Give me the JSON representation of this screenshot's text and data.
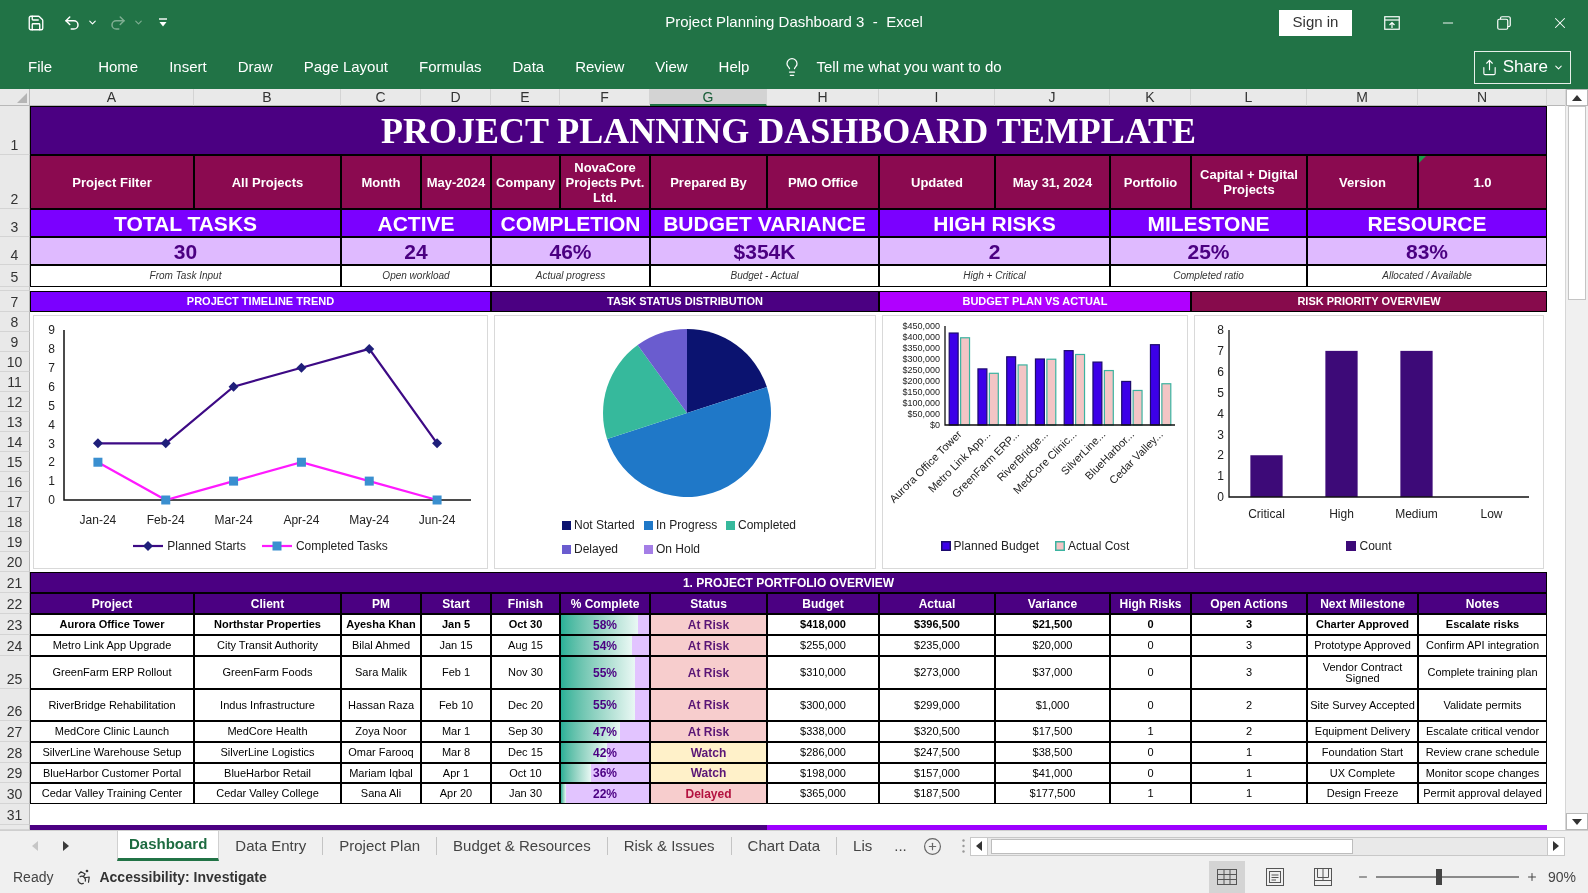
{
  "title_bar": {
    "title": "Project Planning Dashboard 3  -  Excel",
    "sign_in": "Sign in"
  },
  "ribbon": {
    "tabs": [
      "File",
      "Home",
      "Insert",
      "Draw",
      "Page Layout",
      "Formulas",
      "Data",
      "Review",
      "View",
      "Help"
    ],
    "tell_me": "Tell me what you want to do",
    "share": "Share"
  },
  "sheet": {
    "columns": [
      {
        "label": "A",
        "selected": false
      },
      {
        "label": "B",
        "selected": false
      },
      {
        "label": "C",
        "selected": false
      },
      {
        "label": "D",
        "selected": false
      },
      {
        "label": "E",
        "selected": false
      },
      {
        "label": "F",
        "selected": false
      },
      {
        "label": "G",
        "selected": true
      },
      {
        "label": "H",
        "selected": false
      },
      {
        "label": "I",
        "selected": false
      },
      {
        "label": "J",
        "selected": false
      },
      {
        "label": "K",
        "selected": false
      },
      {
        "label": "L",
        "selected": false
      },
      {
        "label": "M",
        "selected": false
      },
      {
        "label": "N",
        "selected": false
      }
    ],
    "row_numbers": [
      "1",
      "2",
      "3",
      "4",
      "5",
      "7",
      "8",
      "9",
      "10",
      "11",
      "12",
      "13",
      "14",
      "15",
      "16",
      "17",
      "18",
      "19",
      "20",
      "21",
      "22",
      "23",
      "24",
      "25",
      "26",
      "27",
      "28",
      "29",
      "30",
      "31"
    ],
    "title": "PROJECT PLANNING DASHBOARD TEMPLATE",
    "info": [
      {
        "label": "Project Filter",
        "value": "All Projects",
        "flagged": false
      },
      {
        "label": "Month",
        "value": "May-2024",
        "flagged": false
      },
      {
        "label": "Company",
        "value": "NovaCore Projects Pvt. Ltd.",
        "flagged": false
      },
      {
        "label": "Prepared By",
        "value": "PMO Office",
        "flagged": false
      },
      {
        "label": "Updated",
        "value": "May 31, 2024",
        "flagged": false
      },
      {
        "label": "Portfolio",
        "value": "Capital + Digital Projects",
        "flagged": false
      },
      {
        "label": "Version",
        "value": "1.0",
        "flagged": true
      }
    ],
    "kpis": [
      {
        "title": "TOTAL TASKS",
        "value": "30",
        "note": "From Task Input"
      },
      {
        "title": "ACTIVE",
        "value": "24",
        "note": "Open workload"
      },
      {
        "title": "COMPLETION",
        "value": "46%",
        "note": "Actual progress"
      },
      {
        "title": "BUDGET VARIANCE",
        "value": "$354K",
        "note": "Budget - Actual"
      },
      {
        "title": "HIGH RISKS",
        "value": "2",
        "note": "High + Critical"
      },
      {
        "title": "MILESTONE",
        "value": "25%",
        "note": "Completed ratio"
      },
      {
        "title": "RESOURCE",
        "value": "83%",
        "note": "Allocated / Available"
      }
    ],
    "charts": [
      {
        "title": "PROJECT TIMELINE TREND",
        "color": "#7b00ff",
        "chart_data": {
          "type": "line",
          "categories": [
            "Jan-24",
            "Feb-24",
            "Mar-24",
            "Apr-24",
            "May-24",
            "Jun-24"
          ],
          "series": [
            {
              "name": "Planned Starts",
              "color": "#3d0a85",
              "marker": "diamond",
              "values": [
                3,
                3,
                6,
                7,
                8,
                3
              ]
            },
            {
              "name": "Completed Tasks",
              "color": "#ff1aff",
              "marker": "square",
              "values": [
                2,
                0,
                1,
                2,
                1,
                0
              ]
            }
          ],
          "ylim": [
            0,
            9
          ],
          "yticks": [
            0,
            1,
            2,
            3,
            4,
            5,
            6,
            7,
            8,
            9
          ],
          "legend": "bottom"
        }
      },
      {
        "title": "TASK STATUS DISTRIBUTION",
        "color": "#4b0082",
        "chart_data": {
          "type": "pie",
          "categories": [
            "Not Started",
            "In Progress",
            "Completed",
            "Delayed",
            "On Hold"
          ],
          "values": [
            20,
            50,
            20,
            10,
            0
          ],
          "colors": [
            "#0b1370",
            "#1f78c8",
            "#36b99c",
            "#6a5ccf",
            "#a47ee6"
          ],
          "legend": "bottom"
        }
      },
      {
        "title": "BUDGET PLAN VS ACTUAL",
        "color": "#b000ff",
        "chart_data": {
          "type": "bar",
          "categories": [
            "Aurora Office Tower",
            "Metro Link App...",
            "GreenFarm ERP...",
            "RiverBridge...",
            "MedCore Clinic...",
            "SilverLine...",
            "BlueHarbor...",
            "Cedar Valley..."
          ],
          "series": [
            {
              "name": "Planned Budget",
              "color": "#3c00e8",
              "values": [
                418000,
                255000,
                310000,
                300000,
                338000,
                286000,
                198000,
                365000
              ]
            },
            {
              "name": "Actual Cost",
              "color": "#f3c5c5",
              "values": [
                396500,
                235000,
                273000,
                299000,
                320500,
                247500,
                157000,
                187500
              ]
            }
          ],
          "stacked": false,
          "ylim": [
            0,
            450000
          ],
          "yticks": [
            {
              "value": 0,
              "label": "$0"
            },
            {
              "value": 50000,
              "label": "$50,000"
            },
            {
              "value": 100000,
              "label": "$100,000"
            },
            {
              "value": 150000,
              "label": "$150,000"
            },
            {
              "value": 200000,
              "label": "$200,000"
            },
            {
              "value": 250000,
              "label": "$250,000"
            },
            {
              "value": 300000,
              "label": "$300,000"
            },
            {
              "value": 350000,
              "label": "$350,000"
            },
            {
              "value": 400000,
              "label": "$400,000"
            },
            {
              "value": 450000,
              "label": "$450,000"
            }
          ],
          "legend": "bottom"
        }
      },
      {
        "title": "RISK PRIORITY OVERVIEW",
        "color": "#870b4c",
        "chart_data": {
          "type": "bar",
          "categories": [
            "Critical",
            "High",
            "Medium",
            "Low"
          ],
          "series": [
            {
              "name": "Count",
              "color": "#3d0a78",
              "values": [
                2,
                7,
                7,
                0
              ]
            }
          ],
          "stacked": false,
          "ylim": [
            0,
            8
          ],
          "yticks": [
            0,
            1,
            2,
            3,
            4,
            5,
            6,
            7,
            8
          ],
          "legend": "bottom"
        }
      }
    ],
    "portfolio": {
      "title": "1. PROJECT PORTFOLIO OVERVIEW",
      "columns": [
        "Project",
        "Client",
        "PM",
        "Start",
        "Finish",
        "% Complete",
        "Status",
        "Budget",
        "Actual",
        "Variance",
        "High Risks",
        "Open Actions",
        "Next Milestone",
        "Notes"
      ],
      "rows": [
        {
          "bold": true,
          "project": "Aurora Office Tower",
          "client": "Northstar Properties",
          "pm": "Ayesha Khan",
          "start": "Jan 5",
          "finish": "Oct 30",
          "complete": {
            "text": "58%",
            "level": 0.88
          },
          "status": {
            "text": "At Risk",
            "kind": "at_risk"
          },
          "budget": "$418,000",
          "actual": "$396,500",
          "variance": "$21,500",
          "high_risks": "0",
          "open_actions": "3",
          "next_milestone": "Charter Approved",
          "notes": "Escalate risks"
        },
        {
          "bold": false,
          "project": "Metro Link App Upgrade",
          "client": "City Transit Authority",
          "pm": "Bilal Ahmed",
          "start": "Jan 15",
          "finish": "Aug 15",
          "complete": {
            "text": "54%",
            "level": 0.81
          },
          "status": {
            "text": "At Risk",
            "kind": "at_risk"
          },
          "budget": "$255,000",
          "actual": "$235,000",
          "variance": "$20,000",
          "high_risks": "0",
          "open_actions": "3",
          "next_milestone": "Prototype Approved",
          "notes": "Confirm API integration"
        },
        {
          "bold": false,
          "project": "GreenFarm ERP Rollout",
          "client": "GreenFarm Foods",
          "pm": "Sara Malik",
          "start": "Feb 1",
          "finish": "Nov 30",
          "complete": {
            "text": "55%",
            "level": 0.84
          },
          "status": {
            "text": "At Risk",
            "kind": "at_risk"
          },
          "budget": "$310,000",
          "actual": "$273,000",
          "variance": "$37,000",
          "high_risks": "0",
          "open_actions": "3",
          "next_milestone": "Vendor Contract Signed",
          "notes": "Complete training plan"
        },
        {
          "bold": false,
          "project": "RiverBridge Rehabilitation",
          "client": "Indus Infrastructure",
          "pm": "Hassan Raza",
          "start": "Feb 10",
          "finish": "Dec 20",
          "complete": {
            "text": "55%",
            "level": 0.84
          },
          "status": {
            "text": "At Risk",
            "kind": "at_risk"
          },
          "budget": "$300,000",
          "actual": "$299,000",
          "variance": "$1,000",
          "high_risks": "0",
          "open_actions": "2",
          "next_milestone": "Site Survey Accepted",
          "notes": "Validate permits"
        },
        {
          "bold": false,
          "project": "MedCore Clinic Launch",
          "client": "MedCore Health",
          "pm": "Zoya Noor",
          "start": "Mar 1",
          "finish": "Sep 30",
          "complete": {
            "text": "47%",
            "level": 0.67
          },
          "status": {
            "text": "At Risk",
            "kind": "at_risk"
          },
          "budget": "$338,000",
          "actual": "$320,500",
          "variance": "$17,500",
          "high_risks": "1",
          "open_actions": "2",
          "next_milestone": "Equipment Delivery",
          "notes": "Escalate critical vendor"
        },
        {
          "bold": false,
          "project": "SilverLine Warehouse Setup",
          "client": "SilverLine Logistics",
          "pm": "Omar Farooq",
          "start": "Mar 8",
          "finish": "Dec 15",
          "complete": {
            "text": "42%",
            "level": 0.52
          },
          "status": {
            "text": "Watch",
            "kind": "watch"
          },
          "budget": "$286,000",
          "actual": "$247,500",
          "variance": "$38,500",
          "high_risks": "0",
          "open_actions": "1",
          "next_milestone": "Foundation Start",
          "notes": "Review crane schedule"
        },
        {
          "bold": false,
          "project": "BlueHarbor Customer Portal",
          "client": "BlueHarbor Retail",
          "pm": "Mariam Iqbal",
          "start": "Apr 1",
          "finish": "Oct 10",
          "complete": {
            "text": "36%",
            "level": 0.34
          },
          "status": {
            "text": "Watch",
            "kind": "watch"
          },
          "budget": "$198,000",
          "actual": "$157,000",
          "variance": "$41,000",
          "high_risks": "0",
          "open_actions": "1",
          "next_milestone": "UX Complete",
          "notes": "Monitor scope changes"
        },
        {
          "bold": false,
          "project": "Cedar Valley Training Center",
          "client": "Cedar Valley College",
          "pm": "Sana Ali",
          "start": "Apr 20",
          "finish": "Jan 30",
          "complete": {
            "text": "22%",
            "level": 0.06
          },
          "status": {
            "text": "Delayed",
            "kind": "delayed"
          },
          "budget": "$365,000",
          "actual": "$187,500",
          "variance": "$177,500",
          "high_risks": "1",
          "open_actions": "1",
          "next_milestone": "Design Freeze",
          "notes": "Permit approval delayed"
        }
      ]
    }
  },
  "sheet_tabs": {
    "tabs": [
      {
        "label": "Dashboard",
        "selected": true
      },
      {
        "label": "Data Entry",
        "selected": false
      },
      {
        "label": "Project Plan",
        "selected": false
      },
      {
        "label": "Budget & Resources",
        "selected": false
      },
      {
        "label": "Risk & Issues",
        "selected": false
      },
      {
        "label": "Chart Data",
        "selected": false
      },
      {
        "label": "Lis",
        "selected": false
      }
    ],
    "more": "..."
  },
  "status_bar": {
    "status": "Ready",
    "accessibility": "Accessibility: Investigate",
    "views": [
      {
        "kind": "normal",
        "selected": true
      },
      {
        "kind": "page_layout",
        "selected": false
      },
      {
        "kind": "page_break",
        "selected": false
      }
    ],
    "zoom": {
      "level": 0.44,
      "reading": "90%"
    }
  }
}
